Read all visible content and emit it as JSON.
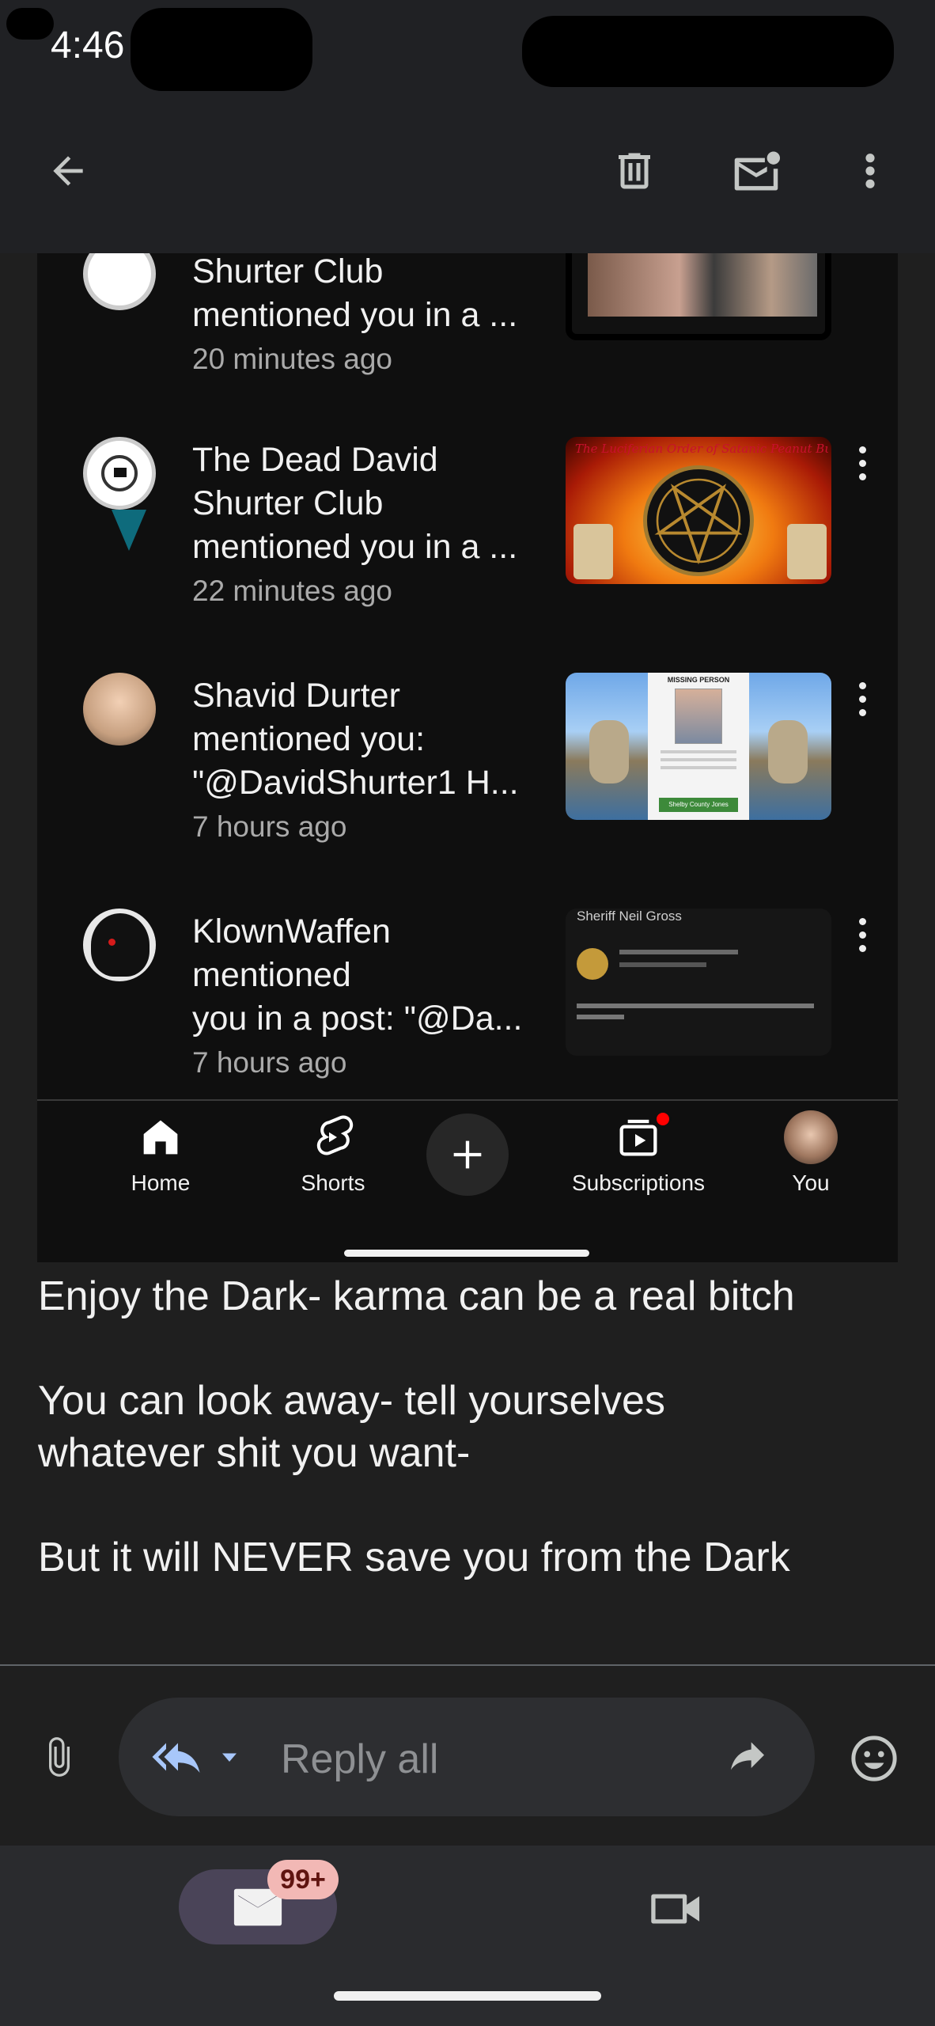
{
  "status_bar": {
    "time": "4:46"
  },
  "top_bar": {
    "back_icon": "arrow-back-icon",
    "actions": [
      "delete-icon",
      "mark-unread-icon",
      "more-vert-icon"
    ]
  },
  "embedded_notifications": [
    {
      "lines": [
        "Shurter Club",
        "mentioned you in a ..."
      ],
      "time": "20 minutes ago"
    },
    {
      "lines": [
        "The Dead David",
        "Shurter Club",
        "mentioned you in a ..."
      ],
      "time": "22 minutes ago",
      "thumb_text": "The Luciferian Order of Satanic Peanut Butter Thieves"
    },
    {
      "lines": [
        "Shavid Durter",
        "mentioned you:",
        "\"@DavidShurter1 H..."
      ],
      "time": "7 hours ago",
      "thumb_text": "MISSING PERSON",
      "thumb_footer": "Shelby County Jones"
    },
    {
      "lines": [
        "KlownWaffen",
        "mentioned",
        "you in a post: \"@Da..."
      ],
      "time": "7 hours ago",
      "thumb_text": "Sheriff Neil Gross"
    }
  ],
  "youtube_nav": [
    {
      "label": "Home"
    },
    {
      "label": "Shorts"
    },
    {
      "label": ""
    },
    {
      "label": "Subscriptions"
    },
    {
      "label": "You"
    }
  ],
  "email_body": [
    "Enjoy the Dark- karma can be a real bitch",
    "You can look away- tell yourselves whatever shit you want-",
    "But it will NEVER save you from the Dark"
  ],
  "reply": {
    "placeholder": "Reply all"
  },
  "bottom_nav": {
    "mail_badge": "99+"
  }
}
